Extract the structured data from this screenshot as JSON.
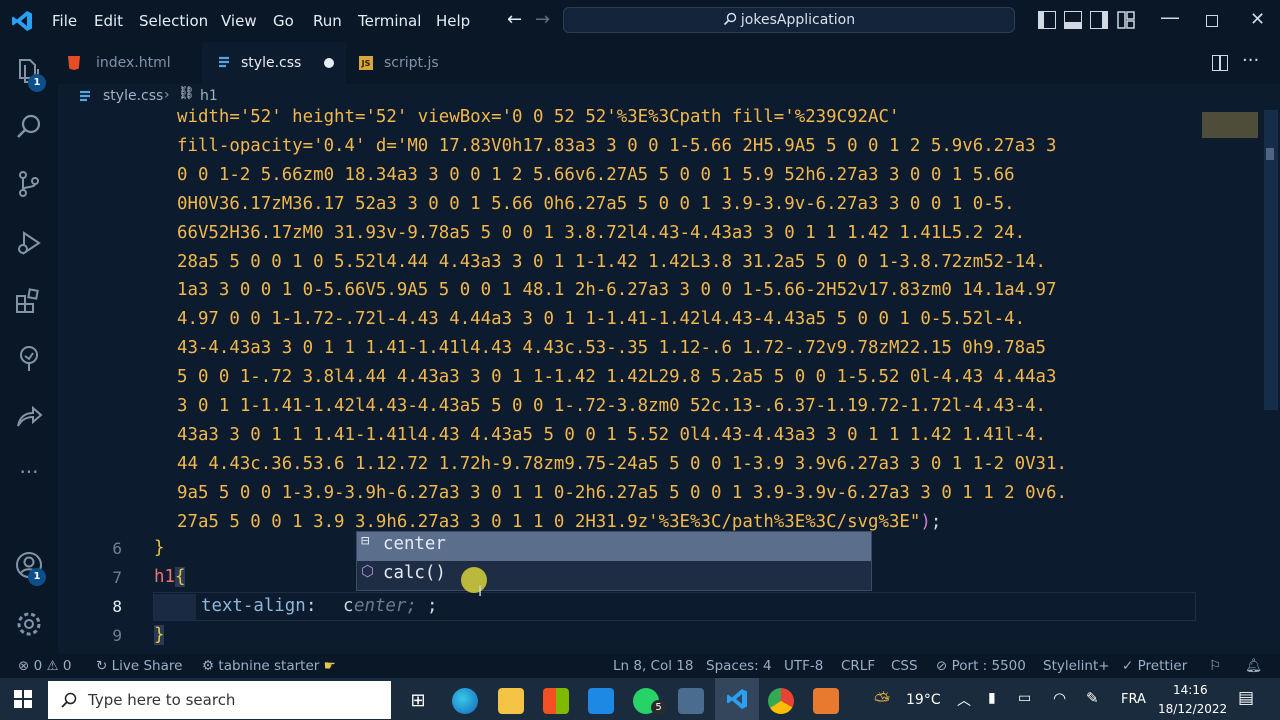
{
  "menu": [
    "File",
    "Edit",
    "Selection",
    "View",
    "Go",
    "Run",
    "Terminal",
    "Help"
  ],
  "search": {
    "label": "jokesApplication"
  },
  "tabs": [
    {
      "name": "index.html",
      "icon": "html5-icon"
    },
    {
      "name": "style.css",
      "icon": "css3-icon",
      "modified": true
    },
    {
      "name": "script.js",
      "icon": "js-icon"
    }
  ],
  "breadcrumb": {
    "file": "style.css",
    "symbol": "h1"
  },
  "badges": {
    "explorer": "1",
    "accounts": "1"
  },
  "editor": {
    "wrapped_lines": [
      "width='52' height='52' viewBox='0 0 52 52'%3E%3Cpath fill='%239C92AC'",
      "fill-opacity='0.4' d='M0 17.83V0h17.83a3 3 0 0 1-5.66 2H5.9A5 5 0 0 1 2 5.9v6.27a3 3",
      "0 0 1-2 5.66zm0 18.34a3 3 0 0 1 2 5.66v6.27A5 5 0 0 1 5.9 52h6.27a3 3 0 0 1 5.66",
      "0H0V36.17zM36.17 52a3 3 0 0 1 5.66 0h6.27a5 5 0 0 1 3.9-3.9v-6.27a3 3 0 0 1 0-5.",
      "66V52H36.17zM0 31.93v-9.78a5 5 0 0 1 3.8.72l4.43-4.43a3 3 0 1 1 1.42 1.41L5.2 24.",
      "28a5 5 0 0 1 0 5.52l4.44 4.43a3 3 0 1 1-1.42 1.42L3.8 31.2a5 5 0 0 1-3.8.72zm52-14.",
      "1a3 3 0 0 1 0-5.66V5.9A5 5 0 0 1 48.1 2h-6.27a3 3 0 0 1-5.66-2H52v17.83zm0 14.1a4.97",
      "4.97 0 0 1-1.72-.72l-4.43 4.44a3 3 0 1 1-1.41-1.42l4.43-4.43a5 5 0 0 1 0-5.52l-4.",
      "43-4.43a3 3 0 1 1 1.41-1.41l4.43 4.43c.53-.35 1.12-.6 1.72-.72v9.78zM22.15 0h9.78a5",
      "5 0 0 1-.72 3.8l4.44 4.43a3 3 0 1 1-1.42 1.42L29.8 5.2a5 5 0 0 1-5.52 0l-4.43 4.44a3",
      "3 0 1 1-1.41-1.42l4.43-4.43a5 5 0 0 1-.72-3.8zm0 52c.13-.6.37-1.19.72-1.72l-4.43-4.",
      "43a3 3 0 1 1 1.41-1.41l4.43 4.43a5 5 0 0 1 5.52 0l4.43-4.43a3 3 0 1 1 1.42 1.41l-4.",
      "44 4.43c.36.53.6 1.12.72 1.72h-9.78zm9.75-24a5 5 0 0 1-3.9 3.9v6.27a3 3 0 1 1-2 0V31.",
      "9a5 5 0 0 1-3.9-3.9h-6.27a3 3 0 1 1 0-2h6.27a5 5 0 0 1 3.9-3.9v-6.27a3 3 0 1 1 2 0v6.",
      "27a5 5 0 0 1 3.9 3.9h6.27a3 3 0 1 1 0 2H31.9z'%3E%3C/path%3E%3C/svg%3E\");"
    ],
    "lines": [
      {
        "num": "6",
        "text": "}"
      },
      {
        "num": "7",
        "selector": "h1",
        "brace": "{"
      },
      {
        "num": "8",
        "property": "text-align",
        "typed": "c",
        "ghost": "enter;",
        "semi": ";"
      },
      {
        "num": "9",
        "text": "}"
      }
    ],
    "suggestions": [
      {
        "label": "center",
        "icon": "enum-value-icon"
      },
      {
        "label": "calc()",
        "icon": "function-cube-icon"
      }
    ]
  },
  "status": {
    "errors": "0",
    "warnings": "0",
    "live_share": "Live Share",
    "tabnine": "tabnine starter",
    "position": "Ln 8, Col 18",
    "spaces": "Spaces: 4",
    "encoding": "UTF-8",
    "eol": "CRLF",
    "language": "CSS",
    "port": "Port : 5500",
    "stylelint": "Stylelint+",
    "prettier": "Prettier"
  },
  "taskbar": {
    "search_placeholder": "Type here to search",
    "weather": "19°C",
    "language": "FRA",
    "time": "14:16",
    "date": "18/12/2022",
    "whatsapp_badge": "5"
  },
  "colors": {
    "string": "#f2b84b",
    "selector": "#f07178",
    "property": "#8fb7d9",
    "accent": "#0c4f8a"
  }
}
